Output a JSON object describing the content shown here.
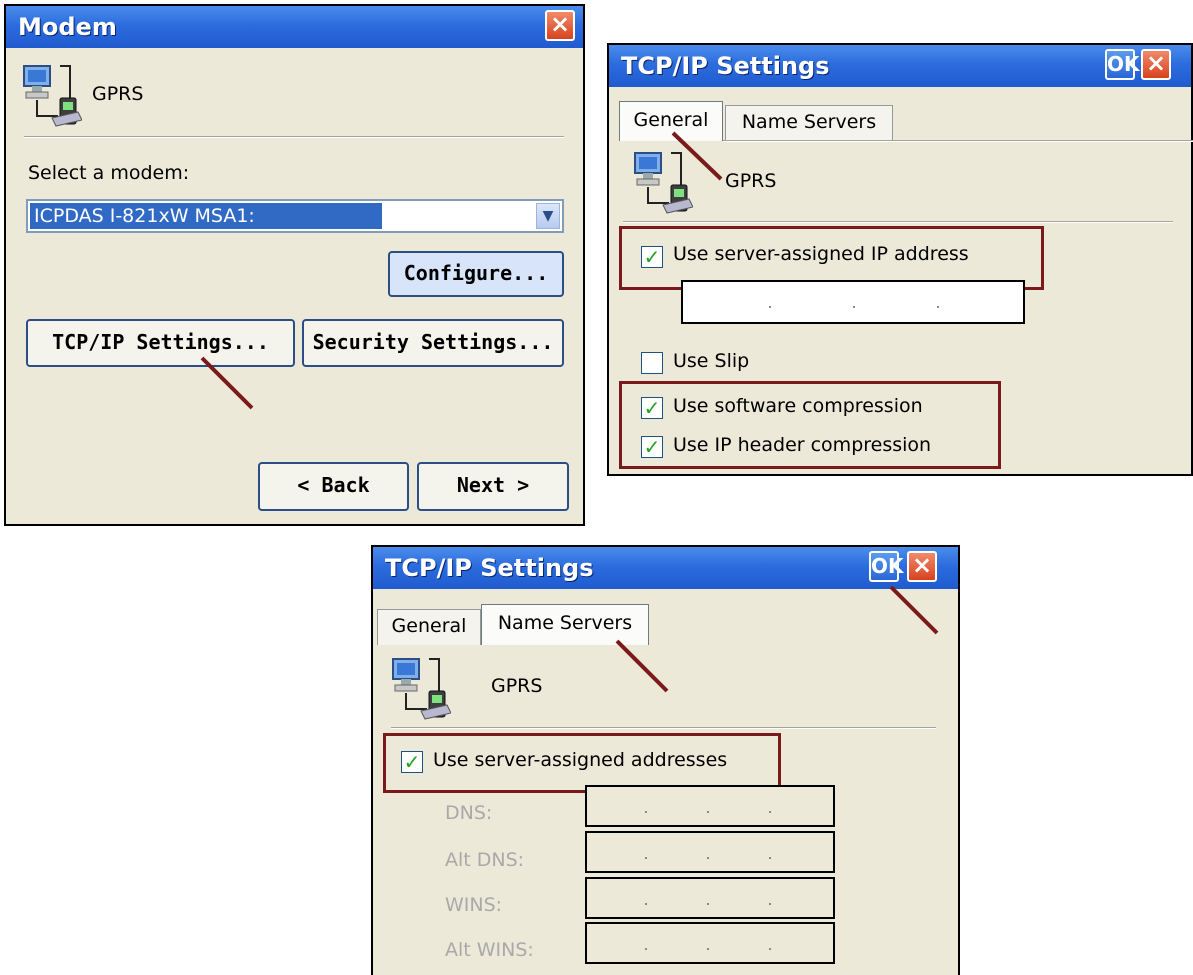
{
  "modem_dialog": {
    "title": "Modem",
    "connection_name": "GPRS",
    "select_label": "Select a modem:",
    "selected_modem": "ICPDAS I-821xW MSA1:",
    "configure_label": "Configure...",
    "tcpip_label": "TCP/IP Settings...",
    "security_label": "Security Settings...",
    "back_label": "< Back",
    "next_label": "Next >",
    "close_icon": "×"
  },
  "tcpip_general": {
    "title": "TCP/IP Settings",
    "ok_label": "OK",
    "close_icon": "×",
    "tabs": [
      "General",
      "Name Servers"
    ],
    "connection_name": "GPRS",
    "server_assigned_ip_label": "Use server-assigned IP address",
    "server_assigned_ip_checked": true,
    "use_slip_label": "Use Slip",
    "use_slip_checked": false,
    "software_compression_label": "Use software compression",
    "software_compression_checked": true,
    "ip_header_compression_label": "Use IP header compression",
    "ip_header_compression_checked": true
  },
  "tcpip_nameservers": {
    "title": "TCP/IP Settings",
    "ok_label": "OK",
    "close_icon": "×",
    "tabs": [
      "General",
      "Name Servers"
    ],
    "connection_name": "GPRS",
    "server_assigned_addresses_label": "Use server-assigned addresses",
    "server_assigned_addresses_checked": true,
    "fields": [
      "DNS:",
      "Alt DNS:",
      "WINS:",
      "Alt WINS:"
    ]
  },
  "icons": [
    "network-connection-icon",
    "close-icon",
    "dropdown-arrow-icon",
    "checkmark-icon"
  ],
  "colors": {
    "titlebar": "#2C6CDE",
    "dialog_bg": "#ECE9D8",
    "highlight": "#316AC5",
    "annotation": "#7A1A1A",
    "check": "#21A121"
  }
}
